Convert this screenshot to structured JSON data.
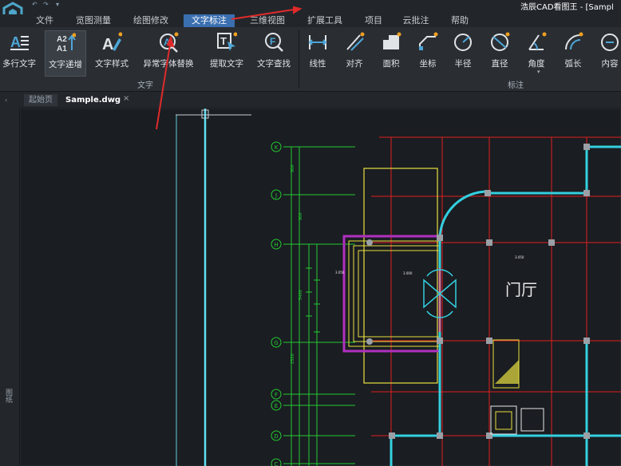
{
  "window": {
    "title": "浩辰CAD看图王 - [Sampl"
  },
  "quick_access": [
    "↶",
    "↷",
    "▾"
  ],
  "menu": {
    "items": [
      {
        "label": "文件"
      },
      {
        "label": "览图测量"
      },
      {
        "label": "绘图修改"
      },
      {
        "label": "文字标注"
      },
      {
        "label": "三维视图"
      },
      {
        "label": "扩展工具"
      },
      {
        "label": "项目"
      },
      {
        "label": "云批注"
      },
      {
        "label": "帮助"
      }
    ],
    "active_index": 3
  },
  "ribbon": {
    "text_group": {
      "label": "文字",
      "buttons": [
        {
          "label": "多行文字",
          "icon": "multiline-text-icon"
        },
        {
          "label": "文字递增",
          "icon": "text-increment-icon"
        },
        {
          "label": "文字样式",
          "icon": "text-style-icon"
        },
        {
          "label": "异常字体替换",
          "icon": "font-replace-icon"
        },
        {
          "label": "提取文字",
          "icon": "extract-text-icon"
        },
        {
          "label": "文字查找",
          "icon": "text-find-icon"
        }
      ]
    },
    "dim_group": {
      "label": "标注",
      "buttons": [
        {
          "label": "线性",
          "icon": "linear-dim-icon"
        },
        {
          "label": "对齐",
          "icon": "aligned-dim-icon"
        },
        {
          "label": "面积",
          "icon": "area-icon"
        },
        {
          "label": "坐标",
          "icon": "coordinate-icon"
        },
        {
          "label": "半径",
          "icon": "radius-icon"
        },
        {
          "label": "直径",
          "icon": "diameter-icon"
        },
        {
          "label": "角度",
          "icon": "angle-icon"
        },
        {
          "label": "弧长",
          "icon": "arc-length-icon"
        },
        {
          "label": "内容",
          "icon": "content-icon"
        }
      ]
    }
  },
  "side_panel": {
    "label": "图纸"
  },
  "doc_tabs": [
    {
      "label": "起始页",
      "active": false
    },
    {
      "label": "Sample.dwg",
      "active": true
    }
  ],
  "tab_close": "×",
  "drawing": {
    "axis_labels": [
      "K",
      "J",
      "H",
      "G",
      "F",
      "E",
      "D",
      "C"
    ],
    "room_label": "门厅"
  },
  "colors": {
    "accent": "#3a6fb0",
    "annotation_arrow": "#e02a2a",
    "grid_red": "#e02020",
    "grid_green": "#22cc33",
    "wall_cyan": "#33d0e0",
    "railing_purple": "#b030c0",
    "box_yellow": "#e8e040"
  }
}
